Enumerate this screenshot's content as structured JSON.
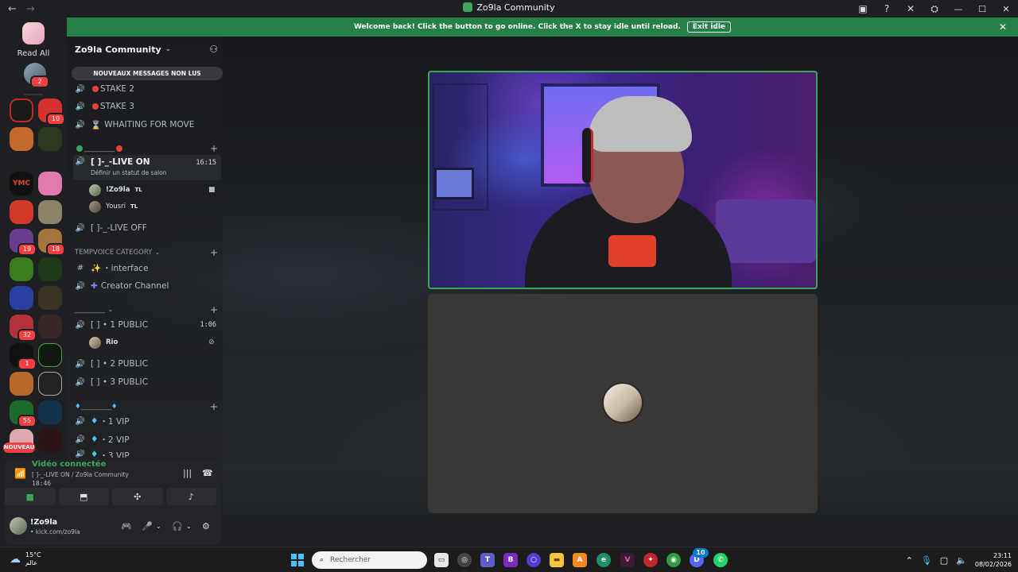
{
  "window": {
    "title": "Zo9la Community"
  },
  "banner": {
    "text": "Welcome back! Click the button to go online. Click the X to stay idle until reload.",
    "button": "Exit idle"
  },
  "rail": {
    "read_all": "Read All",
    "dm_badge": "2",
    "nouveau": "NOUVEAU",
    "servers": [
      {
        "badge": ""
      },
      {
        "badge": "10"
      },
      {
        "badge": ""
      },
      {
        "badge": ""
      },
      {
        "badge": ""
      },
      {
        "badge": ""
      },
      {
        "badge": ""
      },
      {
        "badge": ""
      },
      {
        "badge": "19"
      },
      {
        "badge": "18"
      },
      {
        "badge": ""
      },
      {
        "badge": ""
      },
      {
        "badge": ""
      },
      {
        "badge": ""
      },
      {
        "badge": "32"
      },
      {
        "badge": ""
      },
      {
        "badge": "1"
      },
      {
        "badge": ""
      },
      {
        "badge": ""
      },
      {
        "badge": ""
      },
      {
        "badge": "55"
      },
      {
        "badge": ""
      },
      {
        "badge": ""
      },
      {
        "badge": ""
      }
    ]
  },
  "guild": {
    "name": "Zo9la Community",
    "unread": "NOUVEAUX MESSAGES NON LUS"
  },
  "channels": {
    "stake2": "STAKE 2",
    "stake3": "STAKE 3",
    "waiting": "WHAITING FOR MOVE",
    "cat1": "_________",
    "live_on": "[ ]-_-LIVE ON",
    "live_on_time": "16:15",
    "live_on_sub": "Définir un statut de salon",
    "user1": "!Zo9la",
    "user1_tag": "TL",
    "user2": "Yousri",
    "user2_tag": "TL",
    "live_off": "[ ]-_-LIVE OFF",
    "cat_temp": "TEMPVOICE CATEGORY",
    "interface": "・interface",
    "creator": "Creator Channel",
    "cat3": "_________",
    "pub1": "[ ] • 1 PUBLIC",
    "pub1_time": "1:06",
    "user3": "Rio",
    "pub2": "[ ] • 2 PUBLIC",
    "pub3": "[ ] • 3 PUBLIC",
    "cat4": "_________",
    "vip1": "・1 VIP",
    "vip2": "・2 VIP",
    "vip3": "・3 VIP"
  },
  "voice": {
    "status": "Vidéo connectée",
    "channel": "[ ]-_-LIVE ON / Zo9la Community",
    "time": "18:46"
  },
  "user": {
    "name": "!Zo9la",
    "status": "• kick.com/zo9la"
  },
  "taskbar": {
    "temp": "15°C",
    "place": "عالم",
    "search": "Rechercher",
    "time": "23:11",
    "date": "08/02/2026",
    "discord_badge": "10"
  },
  "colors": {
    "accent_green": "#3ba55c",
    "banner_green": "#248046",
    "badge_red": "#f23f43"
  }
}
